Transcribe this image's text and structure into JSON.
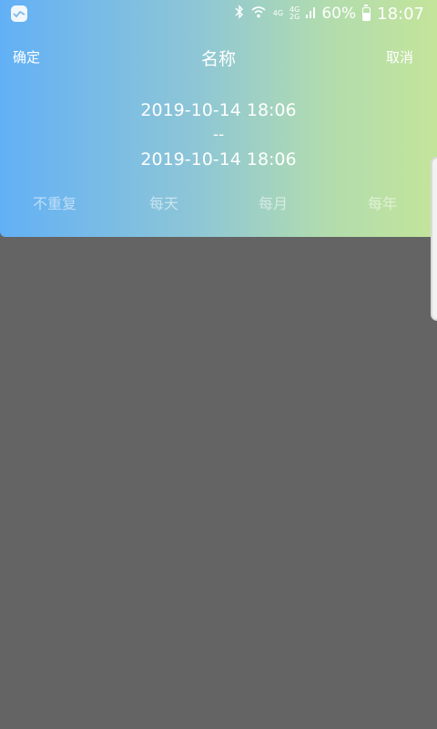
{
  "status_bar": {
    "network_top": "4G",
    "network_dual_top": "4G",
    "network_dual_bottom": "2G",
    "battery_percent": "60%",
    "battery_level": 0.6,
    "time": "18:07",
    "icons": [
      "app-check-icon",
      "bluetooth-icon",
      "wifi-icon",
      "signal-icon",
      "battery-icon"
    ]
  },
  "header": {
    "confirm_label": "确定",
    "title": "名称",
    "cancel_label": "取消"
  },
  "date_range": {
    "start": "2019-10-14 18:06",
    "separator": "--",
    "end": "2019-10-14 18:06"
  },
  "repeat_options": [
    "不重复",
    "每天",
    "每月",
    "每年"
  ],
  "colors": {
    "gradient_start": "#62b0f6",
    "gradient_end": "#c3e49a",
    "overlay": "#646464"
  }
}
